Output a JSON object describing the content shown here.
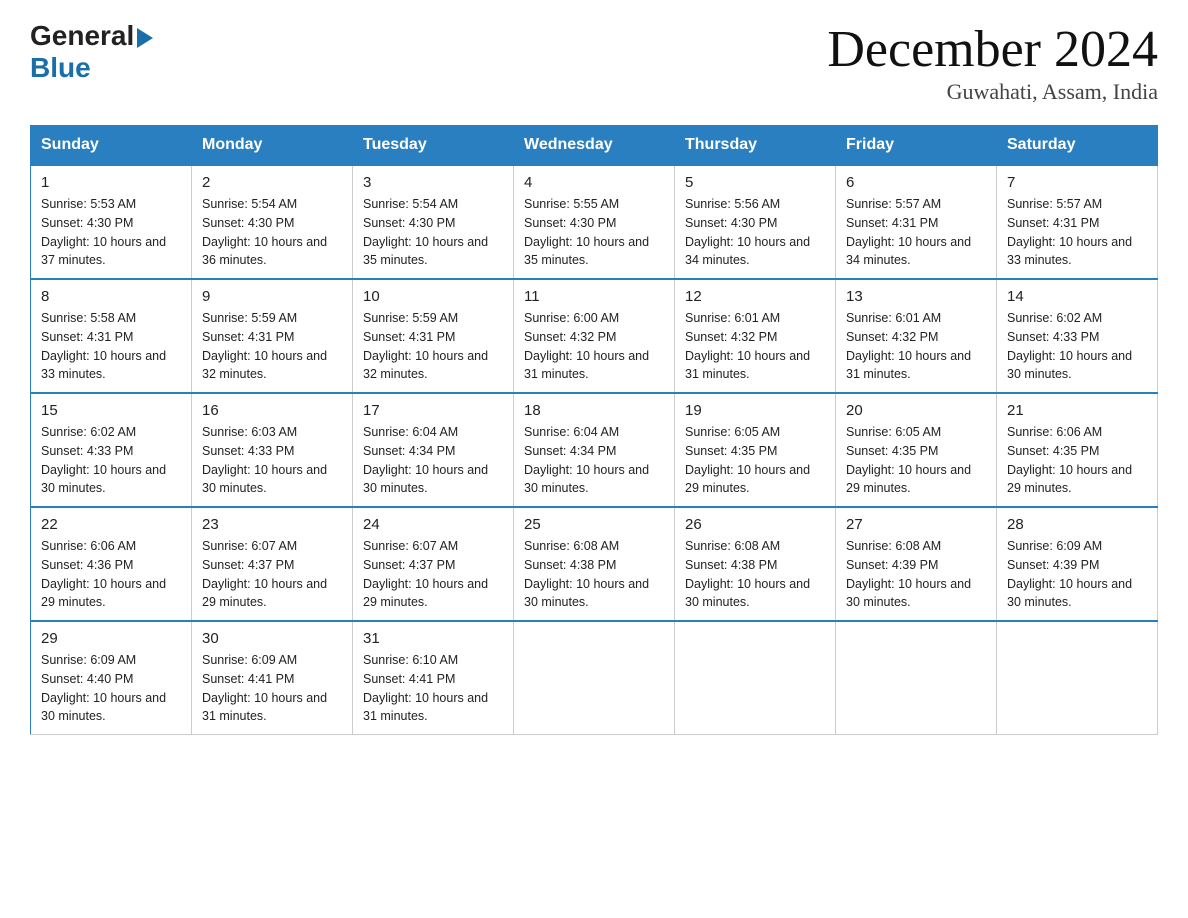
{
  "logo": {
    "general": "General",
    "blue": "Blue"
  },
  "title": "December 2024",
  "location": "Guwahati, Assam, India",
  "days_header": [
    "Sunday",
    "Monday",
    "Tuesday",
    "Wednesday",
    "Thursday",
    "Friday",
    "Saturday"
  ],
  "weeks": [
    [
      {
        "num": "1",
        "sunrise": "5:53 AM",
        "sunset": "4:30 PM",
        "daylight": "10 hours and 37 minutes."
      },
      {
        "num": "2",
        "sunrise": "5:54 AM",
        "sunset": "4:30 PM",
        "daylight": "10 hours and 36 minutes."
      },
      {
        "num": "3",
        "sunrise": "5:54 AM",
        "sunset": "4:30 PM",
        "daylight": "10 hours and 35 minutes."
      },
      {
        "num": "4",
        "sunrise": "5:55 AM",
        "sunset": "4:30 PM",
        "daylight": "10 hours and 35 minutes."
      },
      {
        "num": "5",
        "sunrise": "5:56 AM",
        "sunset": "4:30 PM",
        "daylight": "10 hours and 34 minutes."
      },
      {
        "num": "6",
        "sunrise": "5:57 AM",
        "sunset": "4:31 PM",
        "daylight": "10 hours and 34 minutes."
      },
      {
        "num": "7",
        "sunrise": "5:57 AM",
        "sunset": "4:31 PM",
        "daylight": "10 hours and 33 minutes."
      }
    ],
    [
      {
        "num": "8",
        "sunrise": "5:58 AM",
        "sunset": "4:31 PM",
        "daylight": "10 hours and 33 minutes."
      },
      {
        "num": "9",
        "sunrise": "5:59 AM",
        "sunset": "4:31 PM",
        "daylight": "10 hours and 32 minutes."
      },
      {
        "num": "10",
        "sunrise": "5:59 AM",
        "sunset": "4:31 PM",
        "daylight": "10 hours and 32 minutes."
      },
      {
        "num": "11",
        "sunrise": "6:00 AM",
        "sunset": "4:32 PM",
        "daylight": "10 hours and 31 minutes."
      },
      {
        "num": "12",
        "sunrise": "6:01 AM",
        "sunset": "4:32 PM",
        "daylight": "10 hours and 31 minutes."
      },
      {
        "num": "13",
        "sunrise": "6:01 AM",
        "sunset": "4:32 PM",
        "daylight": "10 hours and 31 minutes."
      },
      {
        "num": "14",
        "sunrise": "6:02 AM",
        "sunset": "4:33 PM",
        "daylight": "10 hours and 30 minutes."
      }
    ],
    [
      {
        "num": "15",
        "sunrise": "6:02 AM",
        "sunset": "4:33 PM",
        "daylight": "10 hours and 30 minutes."
      },
      {
        "num": "16",
        "sunrise": "6:03 AM",
        "sunset": "4:33 PM",
        "daylight": "10 hours and 30 minutes."
      },
      {
        "num": "17",
        "sunrise": "6:04 AM",
        "sunset": "4:34 PM",
        "daylight": "10 hours and 30 minutes."
      },
      {
        "num": "18",
        "sunrise": "6:04 AM",
        "sunset": "4:34 PM",
        "daylight": "10 hours and 30 minutes."
      },
      {
        "num": "19",
        "sunrise": "6:05 AM",
        "sunset": "4:35 PM",
        "daylight": "10 hours and 29 minutes."
      },
      {
        "num": "20",
        "sunrise": "6:05 AM",
        "sunset": "4:35 PM",
        "daylight": "10 hours and 29 minutes."
      },
      {
        "num": "21",
        "sunrise": "6:06 AM",
        "sunset": "4:35 PM",
        "daylight": "10 hours and 29 minutes."
      }
    ],
    [
      {
        "num": "22",
        "sunrise": "6:06 AM",
        "sunset": "4:36 PM",
        "daylight": "10 hours and 29 minutes."
      },
      {
        "num": "23",
        "sunrise": "6:07 AM",
        "sunset": "4:37 PM",
        "daylight": "10 hours and 29 minutes."
      },
      {
        "num": "24",
        "sunrise": "6:07 AM",
        "sunset": "4:37 PM",
        "daylight": "10 hours and 29 minutes."
      },
      {
        "num": "25",
        "sunrise": "6:08 AM",
        "sunset": "4:38 PM",
        "daylight": "10 hours and 30 minutes."
      },
      {
        "num": "26",
        "sunrise": "6:08 AM",
        "sunset": "4:38 PM",
        "daylight": "10 hours and 30 minutes."
      },
      {
        "num": "27",
        "sunrise": "6:08 AM",
        "sunset": "4:39 PM",
        "daylight": "10 hours and 30 minutes."
      },
      {
        "num": "28",
        "sunrise": "6:09 AM",
        "sunset": "4:39 PM",
        "daylight": "10 hours and 30 minutes."
      }
    ],
    [
      {
        "num": "29",
        "sunrise": "6:09 AM",
        "sunset": "4:40 PM",
        "daylight": "10 hours and 30 minutes."
      },
      {
        "num": "30",
        "sunrise": "6:09 AM",
        "sunset": "4:41 PM",
        "daylight": "10 hours and 31 minutes."
      },
      {
        "num": "31",
        "sunrise": "6:10 AM",
        "sunset": "4:41 PM",
        "daylight": "10 hours and 31 minutes."
      },
      null,
      null,
      null,
      null
    ]
  ]
}
